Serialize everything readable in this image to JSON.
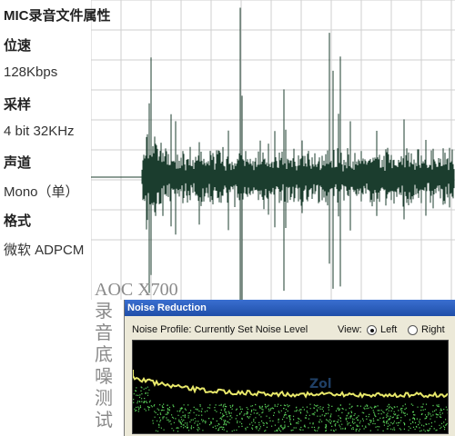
{
  "info": {
    "title": "MIC录音文件属性",
    "rows": [
      {
        "label": "位速",
        "value": "128Kbps"
      },
      {
        "label": "采样",
        "value": "4 bit  32KHz"
      },
      {
        "label": "声道",
        "value": "Mono（单）"
      },
      {
        "label": "格式",
        "value": "微软 ADPCM"
      }
    ]
  },
  "caption": {
    "model": "AOC X700",
    "vertical": [
      "录",
      "音",
      "底",
      "噪",
      "测",
      "试"
    ]
  },
  "noise_window": {
    "title": "Noise Reduction",
    "profile_label": "Noise Profile: Currently Set Noise Level",
    "view_label": "View:",
    "options": [
      {
        "label": "Left",
        "selected": true
      },
      {
        "label": "Right",
        "selected": false
      }
    ]
  },
  "colors": {
    "waveform": "#1b3d2e",
    "grid": "#cfcfcf",
    "titlebar": "#2a5cc0",
    "noise_line": "#e8e86a",
    "noise_dots": "#5ad25a"
  }
}
